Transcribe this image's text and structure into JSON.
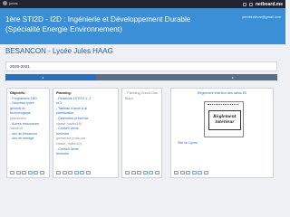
{
  "topbar": {
    "user_name": "jonas",
    "brand": "netboard.me"
  },
  "header": {
    "title": "1ère STI2D - I2D : Ingénierie et Développement Durable (Spécialité Energie Environnement)",
    "email": "jdnnesclevar@gmail.com"
  },
  "school": "BESANCON - Lycée Jules HAAG",
  "year": "2020-2021",
  "cards": {
    "objectifs": {
      "heading": "Objectifs:",
      "lines": [
        "- Programme 1BO",
        "- Nouveau lycée",
        "général et",
        "technologique",
        "(admission",
        "- Autres ressources",
        "Vallon10",
        "- doc ac besancon",
        "- doc en lemage"
      ]
    },
    "planning": {
      "heading": "Planning:",
      "lines": [
        "- Relations 1STI2D 1, 2",
        "et 3",
        "",
        "- Tableau d'avoir à la",
        "planification",
        "",
        "- Calendrier présence",
        "classe (cadbc18)",
        "",
        "- Conseil 2ème",
        "trimestre",
        "(présence profs par",
        "classe, Vallon10)",
        "",
        "- Conseil 3ème",
        "trimestre"
      ]
    },
    "planning_grand_oral": {
      "lines": [
        "- Planning Grand Oral",
        "Blanc"
      ]
    },
    "reglement": {
      "heading": "Règlement intérieur des labos EII",
      "notebook_line1": "Règlement",
      "notebook_line2": "intérieur",
      "site": "Site du Lycée"
    }
  }
}
